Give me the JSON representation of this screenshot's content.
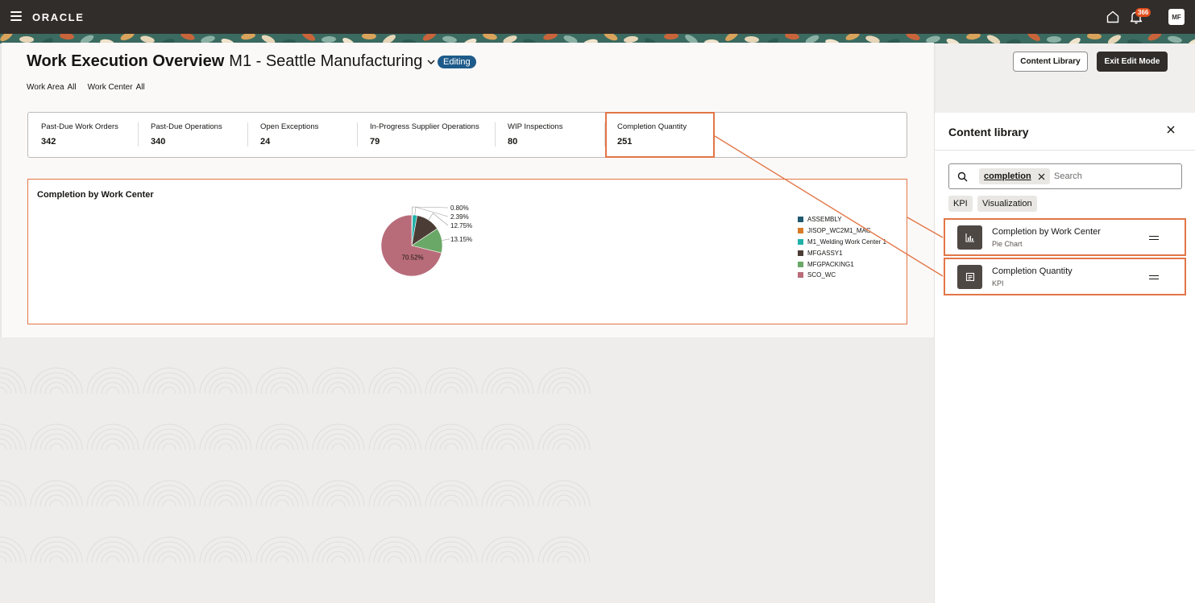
{
  "header": {
    "logo": "ORACLE",
    "notification_count": "366",
    "user_initials": "MF"
  },
  "page": {
    "title": "Work Execution Overview",
    "subtitle": "M1 - Seattle Manufacturing",
    "mode_badge": "Editing",
    "content_library_button": "Content Library",
    "exit_edit_button": "Exit Edit Mode"
  },
  "filters": [
    {
      "label": "Work Area",
      "value": "All"
    },
    {
      "label": "Work Center",
      "value": "All"
    }
  ],
  "kpis": [
    {
      "label": "Past-Due Work Orders",
      "value": "342"
    },
    {
      "label": "Past-Due Operations",
      "value": "340"
    },
    {
      "label": "Open Exceptions",
      "value": "24"
    },
    {
      "label": "In-Progress Supplier Operations",
      "value": "79"
    },
    {
      "label": "WIP Inspections",
      "value": "80"
    },
    {
      "label": "Completion Quantity",
      "value": "251"
    }
  ],
  "chart_data": {
    "type": "pie",
    "title": "Completion by Work Center",
    "categories": [
      "ASSEMBLY",
      "JISOP_WC2M1_MAC",
      "M1_Welding Work Center 1",
      "MFGASSY1",
      "MFGPACKING1",
      "SCO_WC"
    ],
    "values": [
      0.4,
      0.0,
      2.39,
      12.75,
      13.15,
      70.52
    ],
    "labels": [
      "0.80%",
      "2.39%",
      "12.75%",
      "13.15%",
      "70.52%"
    ],
    "colors": [
      "#215a6f",
      "#d77b28",
      "#20b1a8",
      "#4b3d35",
      "#6aa867",
      "#b86c79"
    ],
    "legend_position": "right"
  },
  "side_panel": {
    "title": "Content library",
    "search_chip": "completion",
    "search_placeholder": "Search",
    "type_filters": [
      "KPI",
      "Visualization"
    ],
    "results": [
      {
        "name": "Completion by Work Center",
        "type": "Pie Chart",
        "icon": "chart-icon"
      },
      {
        "name": "Completion Quantity",
        "type": "KPI",
        "icon": "kpi-icon"
      }
    ]
  },
  "colors": {
    "header_bg": "#312d2a",
    "accent_highlight": "#e27646",
    "editing_badge": "#1e5b8a"
  }
}
